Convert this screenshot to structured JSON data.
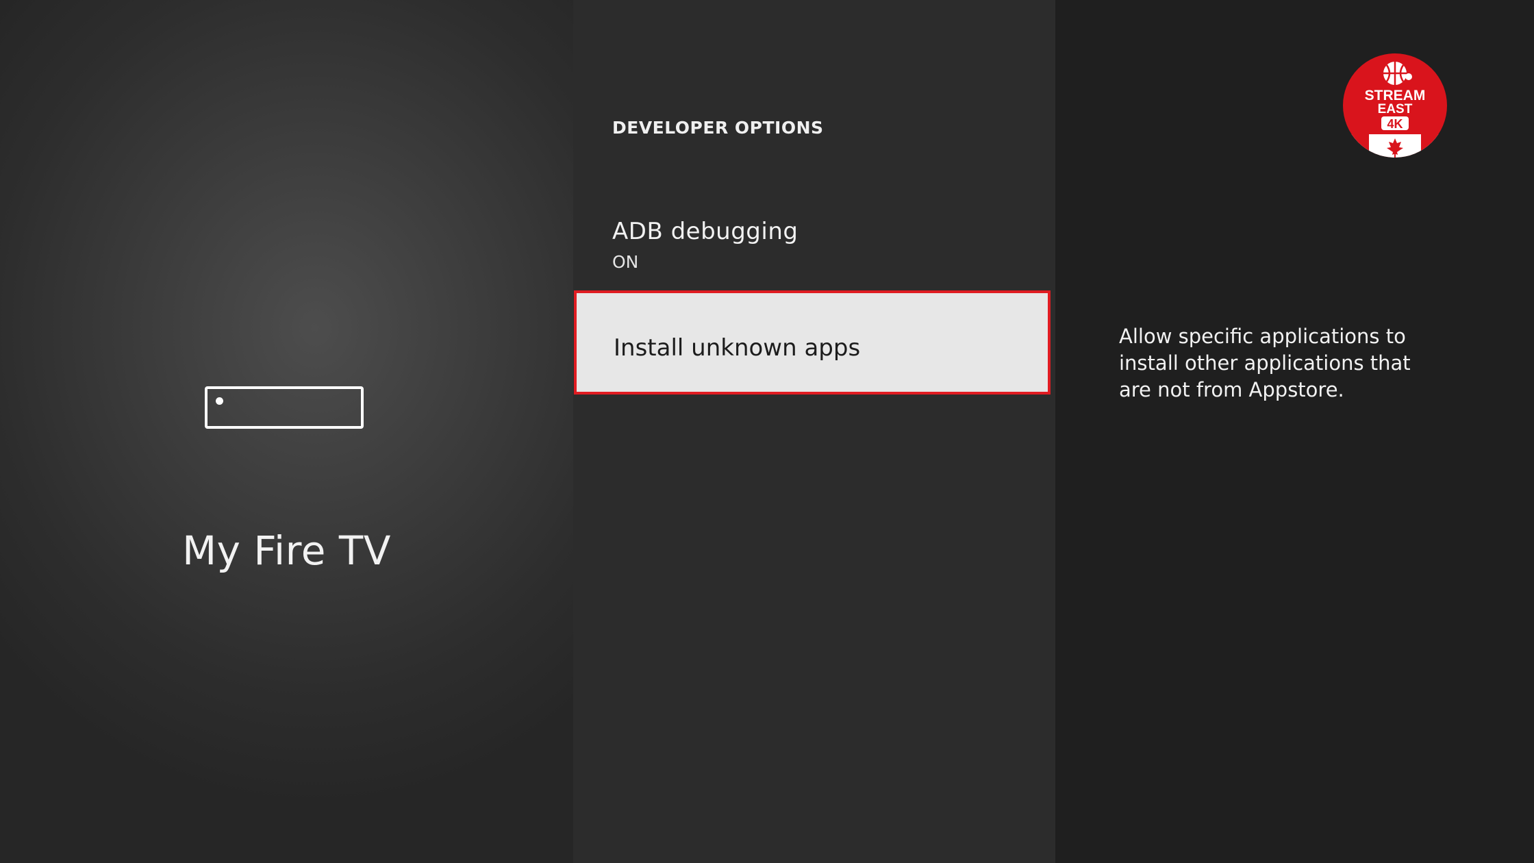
{
  "left_panel": {
    "title": "My Fire TV",
    "icon": "fire-tv-device-icon"
  },
  "middle_panel": {
    "section_title": "DEVELOPER OPTIONS",
    "items": [
      {
        "label": "ADB debugging",
        "value": "ON"
      },
      {
        "label": "Install unknown apps",
        "selected": true
      }
    ]
  },
  "right_panel": {
    "description": "Allow specific applications to install other applications that are not from Appstore."
  },
  "logo": {
    "line1": "STREAM",
    "line2": "EAST",
    "line3": "4K",
    "icon": "basketball-icon"
  },
  "colors": {
    "focus_border": "#e01c22",
    "logo_red": "#d9141c",
    "selected_bg": "#e7e7e7"
  }
}
